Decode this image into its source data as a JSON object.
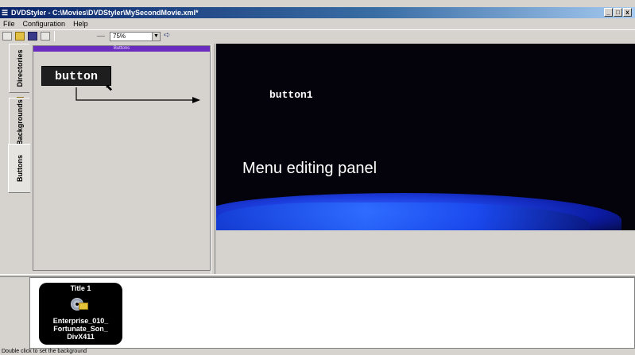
{
  "window": {
    "title": "DVDStyler - C:\\Movies\\DVDStyler\\MySecondMovie.xml*",
    "minimize": "_",
    "restore": "□",
    "close": "x"
  },
  "menubar": {
    "items": [
      "File",
      "Configuration",
      "Help"
    ]
  },
  "toolbar": {
    "zoom_value": "75%",
    "zoom_arrow": "▼",
    "run_arrow": "➪"
  },
  "sidebar": {
    "tabs": [
      "Directories",
      "Backgrounds",
      "Buttons"
    ],
    "active_tab": "Buttons"
  },
  "buttons_panel": {
    "caption": "Buttons",
    "sample_button": "button"
  },
  "menu_canvas": {
    "button_label": "button1",
    "panel_label": "Menu editing panel"
  },
  "titleset": {
    "title_name": "Title 1",
    "file_name": "Enterprise_010_ Fortunate_Son_ DivX411"
  },
  "statusbar": {
    "text": "Double click to set the background"
  },
  "colors": {
    "caption_purple": "#6a2bbf",
    "canvas_bg": "#04020a",
    "glow_blue": "#2c6cff"
  },
  "icons": [
    "new-icon",
    "open-folder-icon",
    "save-icon",
    "save-as-icon",
    "zoom-icon",
    "run-icon",
    "disc-icon",
    "arrow-icon",
    "cursor-icon"
  ]
}
